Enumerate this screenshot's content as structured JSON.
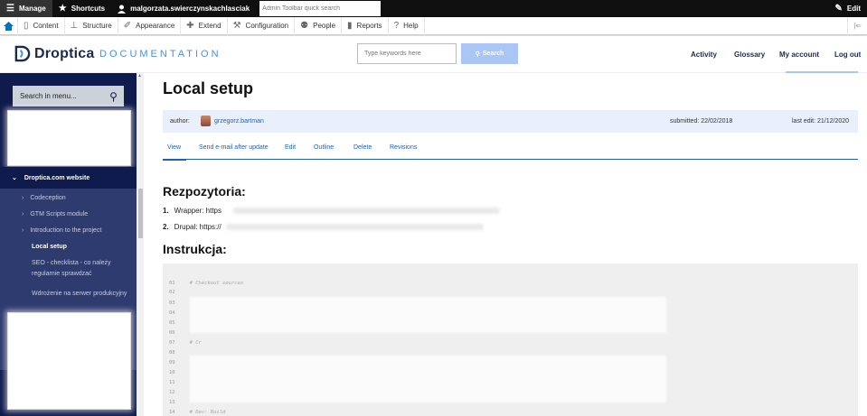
{
  "toolbar": {
    "manage": "Manage",
    "shortcuts": "Shortcuts",
    "username": "malgorzata.swierczynskachlasciak",
    "search_placeholder": "Admin Toolbar quick search",
    "edit": "Edit"
  },
  "tray": {
    "items": [
      "Content",
      "Structure",
      "Appearance",
      "Extend",
      "Configuration",
      "People",
      "Reports",
      "Help"
    ],
    "end": "|⇐"
  },
  "header": {
    "logo": "Droptica",
    "logo_sub": "DOCUMENTATION",
    "search_placeholder": "Type keywords here",
    "search_button": "Search",
    "nav": [
      "Activity",
      "Glossary",
      "My account",
      "Log out"
    ]
  },
  "sidebar": {
    "search_label": "Search in menu...",
    "section": "Droptica.com website",
    "links": [
      "Codeception",
      "GTM Scripts module",
      "Introduction to the project"
    ],
    "active": "Local setup",
    "plain_1": "SEO - checklista - co należy regularnie sprawdzać",
    "plain_2": "Wdrożenie na serwer produkcyjny"
  },
  "page": {
    "title": "Local setup",
    "author_label": "author:",
    "author": "grzegorz.bartman",
    "submitted": "submitted: 22/02/2018",
    "last_edit": "last edit: 21/12/2020",
    "tabs": [
      "View",
      "Send e-mail after update",
      "Edit",
      "Outline",
      "Delete",
      "Revisions"
    ],
    "h_repos": "Rezpozytoria:",
    "repo_1_num": "1.",
    "repo_1": "Wrapper: https",
    "repo_2_num": "2.",
    "repo_2": "Drupal: https://",
    "h_instr": "Instrukcja:",
    "code_lines": [
      "01",
      "02",
      "03",
      "04",
      "05",
      "06",
      "07",
      "08",
      "09",
      "10",
      "11",
      "12",
      "13",
      "14"
    ],
    "code_comment_1": "# Checkout sources",
    "code_comment_2": "# Dev: Build",
    "code_comment_3": "# Cr"
  }
}
